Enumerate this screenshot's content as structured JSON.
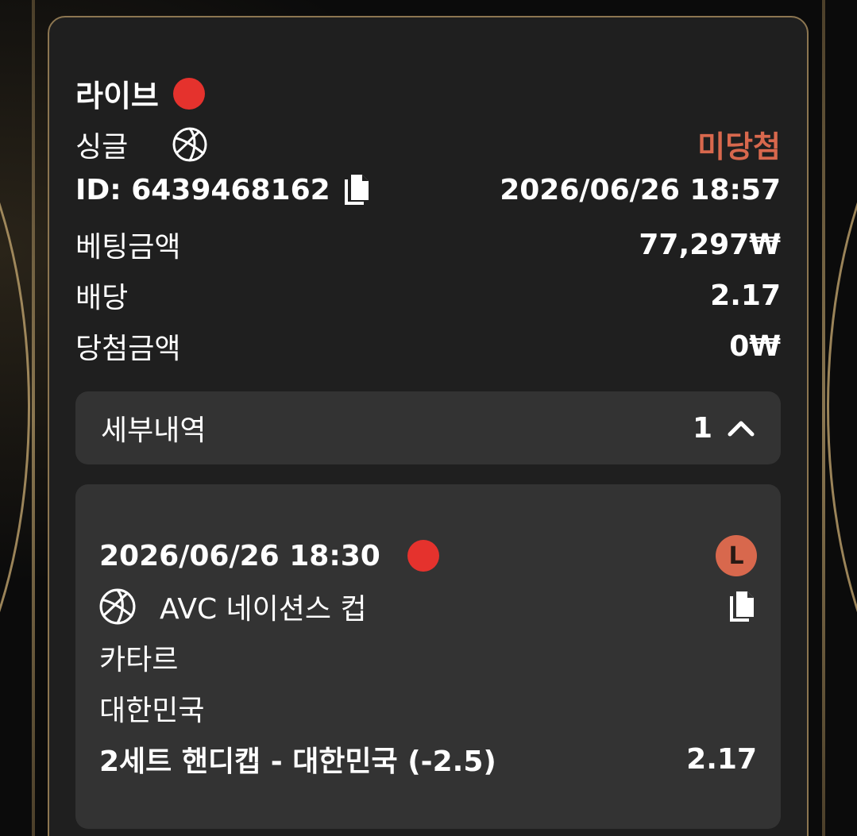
{
  "header": {
    "title": "라이브",
    "bet_type": "싱글",
    "status": "미당첨",
    "id_text": "ID: 6439468162",
    "datetime": "2026/06/26 18:57"
  },
  "summary": {
    "stake_label": "베팅금액",
    "stake_value": "77,297₩",
    "odds_label": "배당",
    "odds_value": "2.17",
    "win_label": "당첨금액",
    "win_value": "0₩"
  },
  "details": {
    "label": "세부내역",
    "count": "1"
  },
  "bet_item": {
    "datetime": "2026/06/26 18:30",
    "result_badge": "L",
    "league": "AVC 네이션스 컵",
    "team1": "카타르",
    "team2": "대한민국",
    "selection": "2세트 핸디캡 - 대한민국 (-2.5)",
    "odds": "2.17"
  },
  "colors": {
    "live_dot": "#e5322d",
    "lost": "#d8684d",
    "card_border": "#8c7651"
  },
  "icons": [
    "volleyball-icon",
    "copy-icon",
    "chevron-up-icon",
    "live-dot-icon"
  ]
}
